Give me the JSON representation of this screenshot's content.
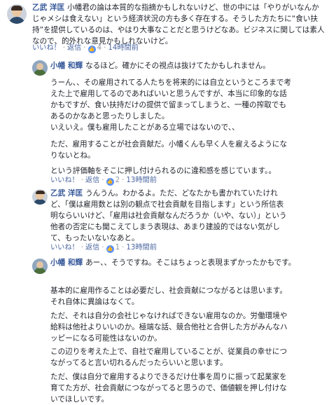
{
  "comments": [
    {
      "author": "乙武 洋匡",
      "text": "小幡君の論は本質的な指摘かもしれないけど、世の中には「やりがいなんかじゃメシは食えない」という経済状況の方も多く存在する。そうした方たちに“食い扶持”を提供しているのは、やはり大事なことだと思うけどなあ。ビジネスに関しては素人なので、的外れな意見かもしれないけど。",
      "like_label": "いいね！",
      "reply_label": "返信",
      "likes": "4",
      "time": "14時間前"
    },
    {
      "author": "小幡 和輝",
      "paragraphs": [
        "なるほど。確かにその視点は抜けてたかもしれません。",
        "うーん、、その雇用されてる人たちを将来的には自立というところまで考えた上で雇用してるのであればいいと思うんですが、本当に印象的な話かもですが、食い扶持だけの提供で留まってしまうと、一種の搾取でもあるのかなあと思ったりしました。",
        "いえいえ。僕も雇用したことがある立場ではないので、、",
        "ただ、雇用することが社会貢献だ。小幡くんも早く人を雇えるようになりないとね。",
        "という評価軸をそこに押し付けられるのに違和感を感じています。。"
      ],
      "like_label": "いいね！",
      "reply_label": "返信",
      "likes": "2",
      "time": "13時間前"
    },
    {
      "author": "乙武 洋匡",
      "text": "うんうん。わかるよ。ただ、どなたかも書かれていたけれど、「僕は雇用数とは別の観点で社会貢献を目指します」という所信表明ならいいけど、「雇用は社会貢献なんだろうか（いや、ない）」という他者の否定にも聞こえてしまう表現は、あまり建設的ではない気がして、もったいないなあと。",
      "like_label": "いいね！",
      "reply_label": "返信",
      "likes": "1",
      "time": "13時間前"
    },
    {
      "author": "小幡 和輝",
      "paragraphs": [
        "あー、、そうですね。そこはちょっと表現まずかったかもです。",
        "基本的に雇用作ることは必要だし、社会貢献につながるとは思います。それ自体に異論はなくて。",
        "ただ、それは自分の会社じゃなければできない雇用なのか。労働環境や給料は他社よりいいのか。極端な話、競合他社と合併した方がみんなハッピーになる可能性はないのか。",
        "この辺りを考えた上で、自社で雇用していることが、従業員の幸せにつながってると言い切れるんだったらいいと思います。",
        "ただ、僕は自分で雇用するよりできるだけ仕事を周りに振って起業家を育てた方が、社会貢献につながってると思うので、価値観を押し付けないでほしいです。"
      ]
    }
  ]
}
